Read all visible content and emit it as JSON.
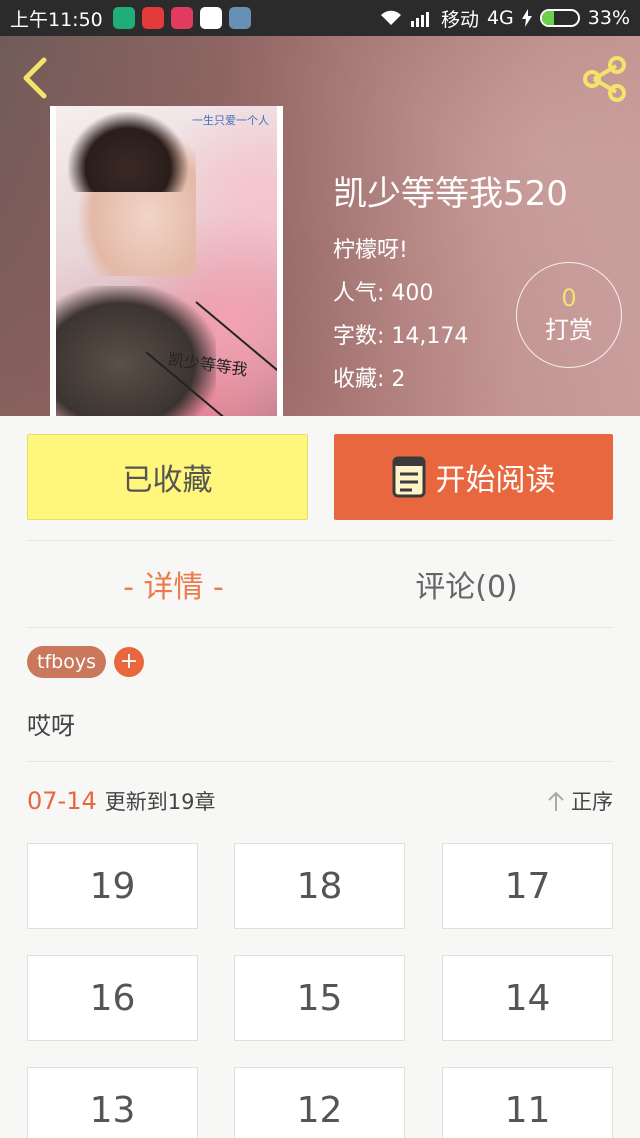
{
  "status_bar": {
    "time": "上午11:50",
    "carrier": "移动",
    "network": "4G",
    "battery": "33%",
    "battery_level": 0.33,
    "app_colors": [
      "#1fae7a",
      "#e33b3b",
      "#e23b60",
      "#222222",
      "#6a8fb5"
    ]
  },
  "book": {
    "title": "凯少等等我520",
    "author": "柠檬呀!",
    "popularity": "人气: 400",
    "word_count": "字数: 14,174",
    "favorites": "收藏: 2",
    "cover_title": "凯少等等我",
    "cover_top_text": "一生只爱一个人"
  },
  "tip": {
    "count": "0",
    "label": "打赏"
  },
  "actions": {
    "favorite_label": "已收藏",
    "read_label": "开始阅读"
  },
  "tabs": [
    {
      "label": "- 详情 -",
      "active": true
    },
    {
      "label": "评论(0)",
      "active": false
    }
  ],
  "tags": [
    "tfboys"
  ],
  "tag_add": "+",
  "intro": "哎呀",
  "update": {
    "date": "07-14",
    "text": "更新到19章",
    "sort_label": "正序"
  },
  "chapters": [
    "19",
    "18",
    "17",
    "16",
    "15",
    "14",
    "13",
    "12",
    "11"
  ],
  "colors": {
    "accent": "#e9673f",
    "favorite_bg": "#fff77b",
    "tip_count": "#f3e36c",
    "tag_bg": "#c9785c"
  },
  "icons": {
    "back": "chevron-left-icon",
    "share": "share-icon",
    "book": "book-icon",
    "sort": "arrow-up-icon"
  }
}
